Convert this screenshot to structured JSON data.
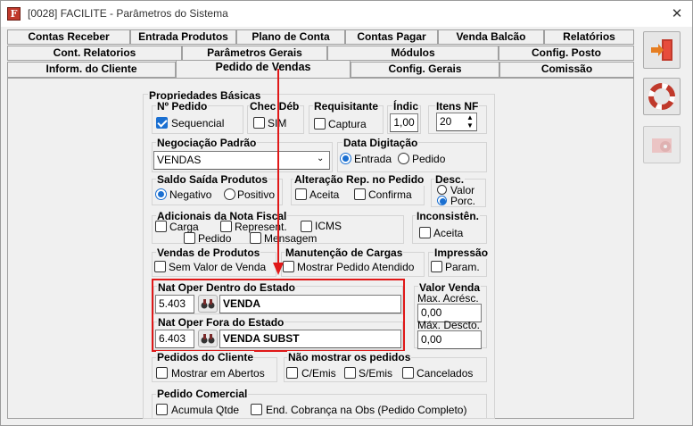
{
  "window": {
    "title": "[0028] FACILITE - Parâmetros do Sistema",
    "app_icon_letter": "F",
    "close_glyph": "✕"
  },
  "tabs": {
    "row1": [
      "Contas Receber",
      "Entrada Produtos",
      "Plano de Conta",
      "Contas Pagar",
      "Venda Balcão",
      "Relatórios"
    ],
    "row2": [
      "Cont. Relatorios",
      "Parâmetros Gerais",
      "Módulos",
      "Config. Posto"
    ],
    "row3": [
      "Inform. do Cliente",
      "Pedido de Vendas",
      "Config. Gerais",
      "Comissão"
    ],
    "active": "Pedido de Vendas"
  },
  "form": {
    "propriedades_basicas": "Propriedades Básicas",
    "n_pedido": {
      "label": "Nº Pedido",
      "checkbox": "Sequencial",
      "checked": true
    },
    "chec_deb": {
      "label": "Chec Déb",
      "checkbox": "SIM",
      "checked": false
    },
    "requisitante": {
      "label": "Requisitante",
      "checkbox": "Captura",
      "checked": false
    },
    "indic": {
      "label": "Índic",
      "value": "1,00"
    },
    "itens_nf": {
      "label": "Itens NF",
      "value": "20"
    },
    "negociacao": {
      "label": "Negociação Padrão",
      "value": "VENDAS"
    },
    "data_digitacao": {
      "label": "Data Digitação",
      "options": [
        "Entrada",
        "Pedido"
      ],
      "selected": "Entrada"
    },
    "saldo_saida": {
      "label": "Saldo Saída Produtos",
      "options": [
        "Negativo",
        "Positivo"
      ],
      "selected": "Negativo"
    },
    "alteracao_rep": {
      "label": "Alteração Rep. no Pedido",
      "aceita": "Aceita",
      "confirma": "Confirma"
    },
    "desc": {
      "label": "Desc.",
      "options": [
        "Valor",
        "Porc."
      ],
      "selected": "Porc."
    },
    "adicionais": {
      "label": "Adicionais da Nota Fiscal",
      "items": [
        "Carga",
        "Represent.",
        "ICMS",
        "Pedido",
        "Mensagem"
      ]
    },
    "inconsisten": {
      "label": "Inconsistên.",
      "checkbox": "Aceita"
    },
    "vendas_produtos": {
      "label": "Vendas de Produtos",
      "checkbox": "Sem Valor de Venda"
    },
    "manutencao_cargas": {
      "label": "Manutenção de Cargas",
      "checkbox": "Mostrar Pedido Atendido"
    },
    "impressao": {
      "label": "Impressão",
      "checkbox": "Param."
    },
    "nat_dentro": {
      "label": "Nat Oper Dentro do Estado",
      "code": "5.403",
      "desc": "VENDA"
    },
    "nat_fora": {
      "label": "Nat Oper Fora do Estado",
      "code": "6.403",
      "desc": "VENDA SUBST"
    },
    "valor_venda": {
      "label": "Valor Venda",
      "max_acresc_label": "Max. Acrésc.",
      "max_acresc": "0,00",
      "max_descto_label": "Máx. Descto.",
      "max_descto": "0,00"
    },
    "pedidos_cliente": {
      "label": "Pedidos do Cliente",
      "checkbox": "Mostrar em Abertos"
    },
    "nao_mostrar": {
      "label": "Não mostrar os pedidos",
      "items": [
        "C/Emis",
        "S/Emis",
        "Cancelados"
      ]
    },
    "pedido_comercial": {
      "label": "Pedido Comercial",
      "items": [
        "Acumula Qtde",
        "End. Cobrança na Obs (Pedido Completo)"
      ]
    }
  },
  "side_buttons": [
    "exit-door-icon",
    "lifebuoy-icon",
    "gear-config-icon"
  ],
  "colors": {
    "highlight": "#e01818",
    "accent": "#1a6fd1",
    "panel": "#f0f0f0"
  }
}
